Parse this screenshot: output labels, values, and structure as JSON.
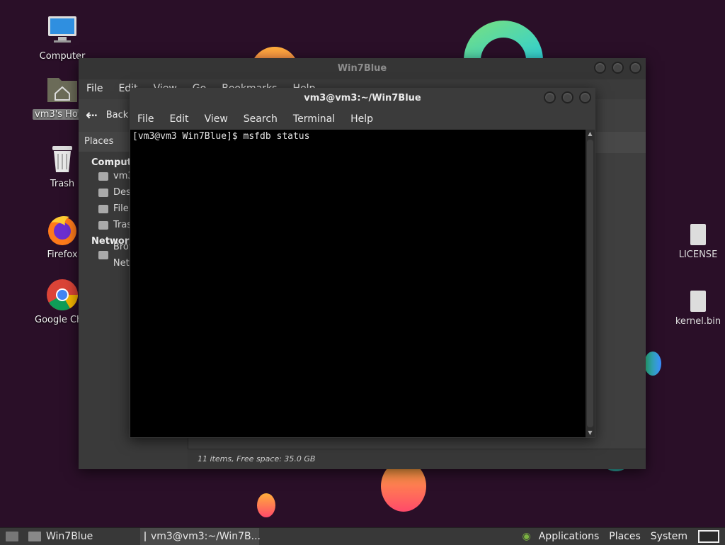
{
  "desktop": {
    "icons": [
      {
        "label": "Computer"
      },
      {
        "label": "vm3's Home"
      },
      {
        "label": "Trash"
      },
      {
        "label": "Firefox"
      },
      {
        "label": "Google Chrome"
      }
    ]
  },
  "file_manager": {
    "title": "Win7Blue",
    "menu": [
      "File",
      "Edit",
      "View",
      "Go",
      "Bookmarks",
      "Help"
    ],
    "back_label": "Back",
    "places_header": "Places",
    "computer_group": "Computer",
    "computer_items": [
      "vm3",
      "Desktop",
      "File System",
      "Trash"
    ],
    "network_group": "Network",
    "network_items": [
      "Browse Network"
    ],
    "visible_files": [
      "LICENSE",
      "kernel.bin"
    ],
    "status": "11 items, Free space: 35.0 GB"
  },
  "terminal": {
    "title": "vm3@vm3:~/Win7Blue",
    "menu": [
      "File",
      "Edit",
      "View",
      "Search",
      "Terminal",
      "Help"
    ],
    "line1": "[vm3@vm3 Win7Blue]$ msfdb status"
  },
  "taskbar": {
    "tasks": [
      {
        "label": "Win7Blue",
        "active": false
      },
      {
        "label": "vm3@vm3:~/Win7B...",
        "active": true
      }
    ],
    "menu": [
      "Applications",
      "Places",
      "System"
    ]
  },
  "colors": {
    "desktop_bg": "#2a0f28",
    "terminal_bg": "#000000",
    "window_chrome": "#3b3b3b"
  }
}
